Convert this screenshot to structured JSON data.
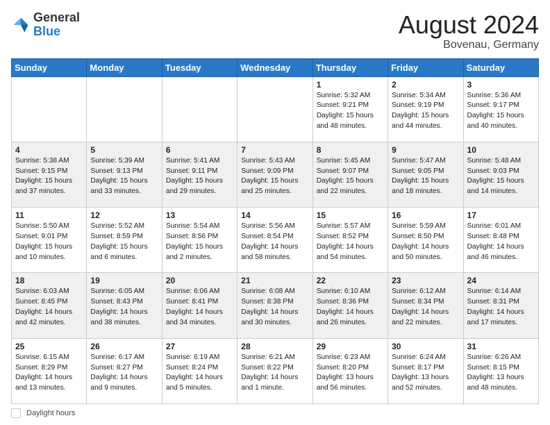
{
  "header": {
    "logo_general": "General",
    "logo_blue": "Blue",
    "month_title": "August 2024",
    "location": "Bovenau, Germany"
  },
  "days_of_week": [
    "Sunday",
    "Monday",
    "Tuesday",
    "Wednesday",
    "Thursday",
    "Friday",
    "Saturday"
  ],
  "footer": {
    "daylight_label": "Daylight hours"
  },
  "weeks": [
    [
      {
        "day": "",
        "info": ""
      },
      {
        "day": "",
        "info": ""
      },
      {
        "day": "",
        "info": ""
      },
      {
        "day": "",
        "info": ""
      },
      {
        "day": "1",
        "info": "Sunrise: 5:32 AM\nSunset: 9:21 PM\nDaylight: 15 hours\nand 48 minutes."
      },
      {
        "day": "2",
        "info": "Sunrise: 5:34 AM\nSunset: 9:19 PM\nDaylight: 15 hours\nand 44 minutes."
      },
      {
        "day": "3",
        "info": "Sunrise: 5:36 AM\nSunset: 9:17 PM\nDaylight: 15 hours\nand 40 minutes."
      }
    ],
    [
      {
        "day": "4",
        "info": "Sunrise: 5:38 AM\nSunset: 9:15 PM\nDaylight: 15 hours\nand 37 minutes."
      },
      {
        "day": "5",
        "info": "Sunrise: 5:39 AM\nSunset: 9:13 PM\nDaylight: 15 hours\nand 33 minutes."
      },
      {
        "day": "6",
        "info": "Sunrise: 5:41 AM\nSunset: 9:11 PM\nDaylight: 15 hours\nand 29 minutes."
      },
      {
        "day": "7",
        "info": "Sunrise: 5:43 AM\nSunset: 9:09 PM\nDaylight: 15 hours\nand 25 minutes."
      },
      {
        "day": "8",
        "info": "Sunrise: 5:45 AM\nSunset: 9:07 PM\nDaylight: 15 hours\nand 22 minutes."
      },
      {
        "day": "9",
        "info": "Sunrise: 5:47 AM\nSunset: 9:05 PM\nDaylight: 15 hours\nand 18 minutes."
      },
      {
        "day": "10",
        "info": "Sunrise: 5:48 AM\nSunset: 9:03 PM\nDaylight: 15 hours\nand 14 minutes."
      }
    ],
    [
      {
        "day": "11",
        "info": "Sunrise: 5:50 AM\nSunset: 9:01 PM\nDaylight: 15 hours\nand 10 minutes."
      },
      {
        "day": "12",
        "info": "Sunrise: 5:52 AM\nSunset: 8:59 PM\nDaylight: 15 hours\nand 6 minutes."
      },
      {
        "day": "13",
        "info": "Sunrise: 5:54 AM\nSunset: 8:56 PM\nDaylight: 15 hours\nand 2 minutes."
      },
      {
        "day": "14",
        "info": "Sunrise: 5:56 AM\nSunset: 8:54 PM\nDaylight: 14 hours\nand 58 minutes."
      },
      {
        "day": "15",
        "info": "Sunrise: 5:57 AM\nSunset: 8:52 PM\nDaylight: 14 hours\nand 54 minutes."
      },
      {
        "day": "16",
        "info": "Sunrise: 5:59 AM\nSunset: 8:50 PM\nDaylight: 14 hours\nand 50 minutes."
      },
      {
        "day": "17",
        "info": "Sunrise: 6:01 AM\nSunset: 8:48 PM\nDaylight: 14 hours\nand 46 minutes."
      }
    ],
    [
      {
        "day": "18",
        "info": "Sunrise: 6:03 AM\nSunset: 8:45 PM\nDaylight: 14 hours\nand 42 minutes."
      },
      {
        "day": "19",
        "info": "Sunrise: 6:05 AM\nSunset: 8:43 PM\nDaylight: 14 hours\nand 38 minutes."
      },
      {
        "day": "20",
        "info": "Sunrise: 6:06 AM\nSunset: 8:41 PM\nDaylight: 14 hours\nand 34 minutes."
      },
      {
        "day": "21",
        "info": "Sunrise: 6:08 AM\nSunset: 8:38 PM\nDaylight: 14 hours\nand 30 minutes."
      },
      {
        "day": "22",
        "info": "Sunrise: 6:10 AM\nSunset: 8:36 PM\nDaylight: 14 hours\nand 26 minutes."
      },
      {
        "day": "23",
        "info": "Sunrise: 6:12 AM\nSunset: 8:34 PM\nDaylight: 14 hours\nand 22 minutes."
      },
      {
        "day": "24",
        "info": "Sunrise: 6:14 AM\nSunset: 8:31 PM\nDaylight: 14 hours\nand 17 minutes."
      }
    ],
    [
      {
        "day": "25",
        "info": "Sunrise: 6:15 AM\nSunset: 8:29 PM\nDaylight: 14 hours\nand 13 minutes."
      },
      {
        "day": "26",
        "info": "Sunrise: 6:17 AM\nSunset: 8:27 PM\nDaylight: 14 hours\nand 9 minutes."
      },
      {
        "day": "27",
        "info": "Sunrise: 6:19 AM\nSunset: 8:24 PM\nDaylight: 14 hours\nand 5 minutes."
      },
      {
        "day": "28",
        "info": "Sunrise: 6:21 AM\nSunset: 8:22 PM\nDaylight: 14 hours\nand 1 minute."
      },
      {
        "day": "29",
        "info": "Sunrise: 6:23 AM\nSunset: 8:20 PM\nDaylight: 13 hours\nand 56 minutes."
      },
      {
        "day": "30",
        "info": "Sunrise: 6:24 AM\nSunset: 8:17 PM\nDaylight: 13 hours\nand 52 minutes."
      },
      {
        "day": "31",
        "info": "Sunrise: 6:26 AM\nSunset: 8:15 PM\nDaylight: 13 hours\nand 48 minutes."
      }
    ]
  ]
}
